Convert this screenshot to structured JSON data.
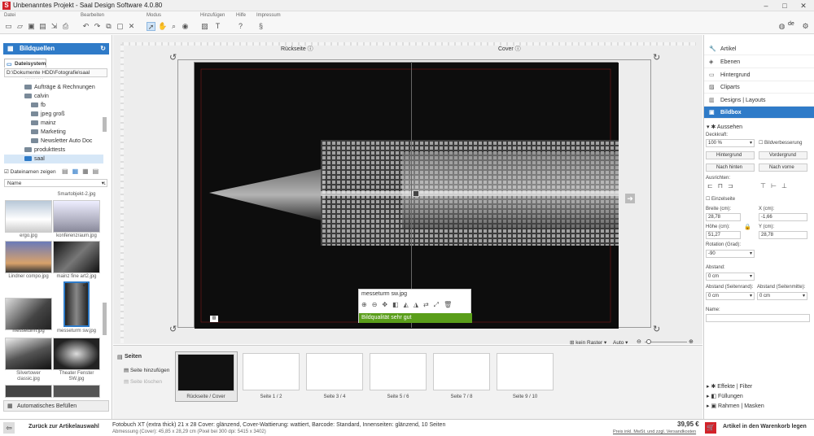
{
  "window": {
    "title": "Unbenanntes Projekt - Saal Design Software 4.0.80"
  },
  "menu": {
    "groups": [
      "Datei",
      "Bearbeiten",
      "Modus",
      "Hinzufügen",
      "Hilfe",
      "Impressum"
    ],
    "lang": "de"
  },
  "left": {
    "title": "Bildquellen",
    "tab": "Dateisystem",
    "path": "D:\\Dokumente HDD\\Fotografie\\saal",
    "tree": [
      "Aufträge & Rechnungen",
      "calvin",
      "fb",
      "jpeg groß",
      "mainz",
      "Marketing",
      "Newsletter Auto Doc",
      "produkttests",
      "saal"
    ],
    "show_names": "Dateinamen zeigen",
    "sort": "Name",
    "thumbs": [
      "Smartobjekt-2.jpg",
      "ergo.jpg",
      "konferenzraum.jpg",
      "Lindner compo.jpg",
      "mainz fine art2.jpg",
      "messeturm.jpg",
      "messeturm sw.jpg",
      "Silvertower classic.jpg",
      "Theater Fenster SW.jpg"
    ],
    "autofill": "Automatisches Befüllen"
  },
  "canvas": {
    "back_label": "Rückseite",
    "cover_label": "Cover",
    "tooltip_file": "messeturm sw.jpg",
    "quality": "Bildqualität sehr gut",
    "grid": "kein Raster",
    "zoom": "Auto"
  },
  "right": {
    "items": [
      "Artikel",
      "Ebenen",
      "Hintergrund",
      "Cliparts",
      "Designs | Layouts",
      "Bildbox"
    ],
    "section": "Aussehen",
    "deckkraft_label": "Deckkraft:",
    "deckkraft": "100 %",
    "bildverb": "Bildverbesserung",
    "btn_hinter": "Hintergrund",
    "btn_vorder": "Vordergrund",
    "btn_nachhinten": "Nach hinten",
    "btn_nachvorne": "Nach vorne",
    "ausrichten": "Ausrichten:",
    "einzelseite": "Einzelseite",
    "breite_label": "Breite (cm):",
    "breite": "28,78",
    "x_label": "X (cm):",
    "x": "-1,66",
    "hoehe_label": "Höhe (cm):",
    "hoehe": "51,27",
    "y_label": "Y (cm):",
    "y": "28,78",
    "rot_label": "Rotation (Grad):",
    "rot": "-90",
    "abstand_label": "Abstand:",
    "abstand": "0 cm",
    "abst_rand_label": "Abstand (Seitenrand):",
    "abst_rand": "0 cm",
    "abst_mitte_label": "Abstand (Seitenmitte):",
    "abst_mitte": "0 cm",
    "name_label": "Name:",
    "bottom": [
      "Effekte | Filter",
      "Füllungen",
      "Rahmen | Masken"
    ]
  },
  "pages": {
    "title": "Seiten",
    "add": "Seite hinzufügen",
    "del": "Seite löschen",
    "labels": [
      "Rückseite / Cover",
      "Seite 1 / 2",
      "Seite 3 / 4",
      "Seite 5 / 6",
      "Seite 7 / 8",
      "Seite 9 / 10"
    ]
  },
  "footer": {
    "back": "Zurück zur Artikelauswahl",
    "desc1": "Fotobuch XT (extra thick) 21 x 28 Cover: glänzend, Cover-Wattierung: wattiert, Barcode: Standard, Innenseiten: glänzend, 10 Seiten",
    "desc2": "Abmessung (Cover): 45,85 x 28,29 cm (Pixel bei 300 dpi: 5415 x 3402)",
    "price": "39,95 €",
    "price_note": "Preis inkl. MwSt. und zzgl. Versandkosten",
    "cart": "Artikel in den Warenkorb legen"
  }
}
